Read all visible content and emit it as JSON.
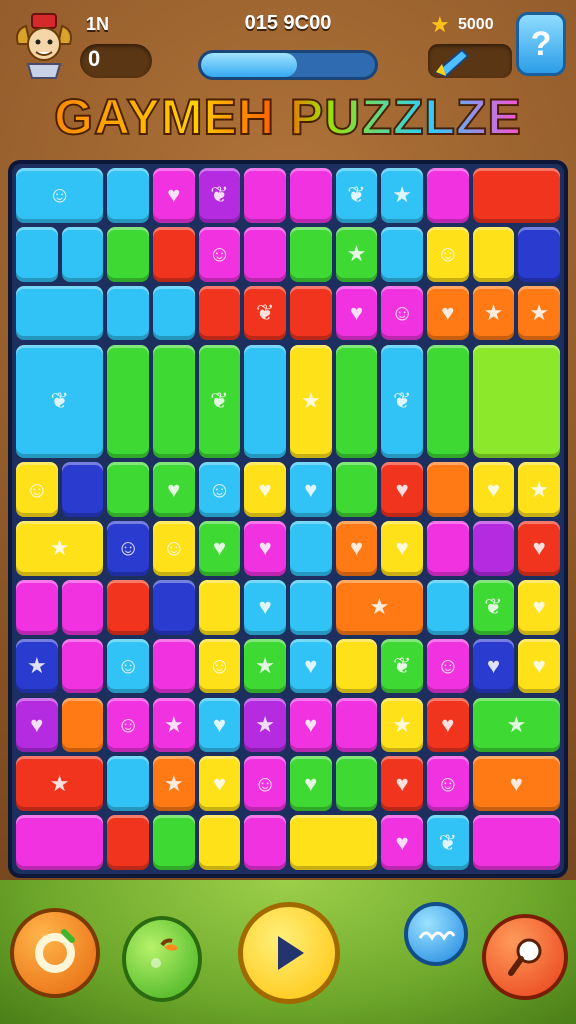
{
  "hud": {
    "level_label": "1N",
    "level_value": "0",
    "score_text": "015 9C00",
    "progress_fraction": 0.55,
    "coins_text": "5000"
  },
  "title": "GAYMEH PUZZLZE",
  "colors": {
    "cyan": "#31c3f5",
    "magenta": "#f032e0",
    "purple": "#b52be0",
    "green": "#3fd934",
    "lime": "#8be82a",
    "yellow": "#ffe11a",
    "orange": "#ff7a14",
    "red": "#f0341e",
    "navy": "#2a3bd0",
    "board": "#1d2f5e"
  },
  "board": {
    "cols": 12,
    "rows": 12,
    "tiles": [
      {
        "c": 0,
        "r": 0,
        "w": 2,
        "h": 1,
        "color": "cyan",
        "icon": "ghost-face"
      },
      {
        "c": 2,
        "r": 0,
        "w": 1,
        "h": 1,
        "color": "cyan"
      },
      {
        "c": 3,
        "r": 0,
        "w": 1,
        "h": 1,
        "color": "magenta",
        "icon": "heart"
      },
      {
        "c": 4,
        "r": 0,
        "w": 1,
        "h": 1,
        "color": "purple",
        "icon": "leaf"
      },
      {
        "c": 5,
        "r": 0,
        "w": 1,
        "h": 1,
        "color": "magenta"
      },
      {
        "c": 6,
        "r": 0,
        "w": 1,
        "h": 1,
        "color": "magenta"
      },
      {
        "c": 7,
        "r": 0,
        "w": 1,
        "h": 1,
        "color": "cyan",
        "icon": "leaf"
      },
      {
        "c": 8,
        "r": 0,
        "w": 1,
        "h": 1,
        "color": "cyan",
        "icon": "star"
      },
      {
        "c": 9,
        "r": 0,
        "w": 1,
        "h": 1,
        "color": "magenta"
      },
      {
        "c": 10,
        "r": 0,
        "w": 2,
        "h": 1,
        "color": "red"
      },
      {
        "c": 0,
        "r": 1,
        "w": 1,
        "h": 1,
        "color": "cyan"
      },
      {
        "c": 1,
        "r": 1,
        "w": 1,
        "h": 1,
        "color": "cyan"
      },
      {
        "c": 2,
        "r": 1,
        "w": 1,
        "h": 1,
        "color": "green"
      },
      {
        "c": 3,
        "r": 1,
        "w": 1,
        "h": 1,
        "color": "red"
      },
      {
        "c": 4,
        "r": 1,
        "w": 1,
        "h": 1,
        "color": "magenta",
        "icon": "face"
      },
      {
        "c": 5,
        "r": 1,
        "w": 1,
        "h": 1,
        "color": "magenta"
      },
      {
        "c": 6,
        "r": 1,
        "w": 1,
        "h": 1,
        "color": "green"
      },
      {
        "c": 7,
        "r": 1,
        "w": 1,
        "h": 1,
        "color": "green",
        "icon": "star"
      },
      {
        "c": 8,
        "r": 1,
        "w": 1,
        "h": 1,
        "color": "cyan"
      },
      {
        "c": 9,
        "r": 1,
        "w": 1,
        "h": 1,
        "color": "yellow",
        "icon": "face"
      },
      {
        "c": 10,
        "r": 1,
        "w": 1,
        "h": 1,
        "color": "yellow"
      },
      {
        "c": 11,
        "r": 1,
        "w": 1,
        "h": 1,
        "color": "navy"
      },
      {
        "c": 0,
        "r": 2,
        "w": 2,
        "h": 1,
        "color": "cyan"
      },
      {
        "c": 2,
        "r": 2,
        "w": 1,
        "h": 1,
        "color": "cyan"
      },
      {
        "c": 3,
        "r": 2,
        "w": 1,
        "h": 1,
        "color": "cyan"
      },
      {
        "c": 4,
        "r": 2,
        "w": 1,
        "h": 1,
        "color": "red"
      },
      {
        "c": 5,
        "r": 2,
        "w": 1,
        "h": 1,
        "color": "red",
        "icon": "leaf"
      },
      {
        "c": 6,
        "r": 2,
        "w": 1,
        "h": 1,
        "color": "red"
      },
      {
        "c": 7,
        "r": 2,
        "w": 1,
        "h": 1,
        "color": "magenta",
        "icon": "heart"
      },
      {
        "c": 8,
        "r": 2,
        "w": 1,
        "h": 1,
        "color": "magenta",
        "icon": "face"
      },
      {
        "c": 9,
        "r": 2,
        "w": 1,
        "h": 1,
        "color": "orange",
        "icon": "heart"
      },
      {
        "c": 10,
        "r": 2,
        "w": 1,
        "h": 1,
        "color": "orange",
        "icon": "star"
      },
      {
        "c": 11,
        "r": 2,
        "w": 1,
        "h": 1,
        "color": "orange",
        "icon": "star"
      },
      {
        "c": 0,
        "r": 3,
        "w": 2,
        "h": 2,
        "color": "cyan",
        "icon": "leaf"
      },
      {
        "c": 2,
        "r": 3,
        "w": 1,
        "h": 2,
        "color": "green"
      },
      {
        "c": 3,
        "r": 3,
        "w": 1,
        "h": 2,
        "color": "green"
      },
      {
        "c": 4,
        "r": 3,
        "w": 1,
        "h": 2,
        "color": "green",
        "icon": "leaf"
      },
      {
        "c": 5,
        "r": 3,
        "w": 1,
        "h": 2,
        "color": "cyan"
      },
      {
        "c": 6,
        "r": 3,
        "w": 1,
        "h": 2,
        "color": "yellow",
        "icon": "star"
      },
      {
        "c": 7,
        "r": 3,
        "w": 1,
        "h": 2,
        "color": "green"
      },
      {
        "c": 8,
        "r": 3,
        "w": 1,
        "h": 2,
        "color": "cyan",
        "icon": "leaf"
      },
      {
        "c": 9,
        "r": 3,
        "w": 1,
        "h": 2,
        "color": "green"
      },
      {
        "c": 10,
        "r": 3,
        "w": 2,
        "h": 2,
        "color": "lime"
      },
      {
        "c": 0,
        "r": 5,
        "w": 1,
        "h": 1,
        "color": "yellow",
        "icon": "face"
      },
      {
        "c": 1,
        "r": 5,
        "w": 1,
        "h": 1,
        "color": "navy"
      },
      {
        "c": 2,
        "r": 5,
        "w": 1,
        "h": 1,
        "color": "green"
      },
      {
        "c": 3,
        "r": 5,
        "w": 1,
        "h": 1,
        "color": "green",
        "icon": "heart"
      },
      {
        "c": 4,
        "r": 5,
        "w": 1,
        "h": 1,
        "color": "cyan",
        "icon": "face"
      },
      {
        "c": 5,
        "r": 5,
        "w": 1,
        "h": 1,
        "color": "yellow",
        "icon": "heart"
      },
      {
        "c": 6,
        "r": 5,
        "w": 1,
        "h": 1,
        "color": "cyan",
        "icon": "heart"
      },
      {
        "c": 7,
        "r": 5,
        "w": 1,
        "h": 1,
        "color": "green"
      },
      {
        "c": 8,
        "r": 5,
        "w": 1,
        "h": 1,
        "color": "red",
        "icon": "heart"
      },
      {
        "c": 9,
        "r": 5,
        "w": 1,
        "h": 1,
        "color": "orange"
      },
      {
        "c": 10,
        "r": 5,
        "w": 1,
        "h": 1,
        "color": "yellow",
        "icon": "heart"
      },
      {
        "c": 11,
        "r": 5,
        "w": 1,
        "h": 1,
        "color": "yellow",
        "icon": "star"
      },
      {
        "c": 0,
        "r": 6,
        "w": 2,
        "h": 1,
        "color": "yellow",
        "icon": "star"
      },
      {
        "c": 2,
        "r": 6,
        "w": 1,
        "h": 1,
        "color": "navy",
        "icon": "face"
      },
      {
        "c": 3,
        "r": 6,
        "w": 1,
        "h": 1,
        "color": "yellow",
        "icon": "face"
      },
      {
        "c": 4,
        "r": 6,
        "w": 1,
        "h": 1,
        "color": "green",
        "icon": "heart"
      },
      {
        "c": 5,
        "r": 6,
        "w": 1,
        "h": 1,
        "color": "magenta",
        "icon": "heart"
      },
      {
        "c": 6,
        "r": 6,
        "w": 1,
        "h": 1,
        "color": "cyan"
      },
      {
        "c": 7,
        "r": 6,
        "w": 1,
        "h": 1,
        "color": "orange",
        "icon": "heart"
      },
      {
        "c": 8,
        "r": 6,
        "w": 1,
        "h": 1,
        "color": "yellow",
        "icon": "heart"
      },
      {
        "c": 9,
        "r": 6,
        "w": 1,
        "h": 1,
        "color": "magenta"
      },
      {
        "c": 10,
        "r": 6,
        "w": 1,
        "h": 1,
        "color": "purple"
      },
      {
        "c": 11,
        "r": 6,
        "w": 1,
        "h": 1,
        "color": "red",
        "icon": "heart"
      },
      {
        "c": 0,
        "r": 7,
        "w": 1,
        "h": 1,
        "color": "magenta"
      },
      {
        "c": 1,
        "r": 7,
        "w": 1,
        "h": 1,
        "color": "magenta"
      },
      {
        "c": 2,
        "r": 7,
        "w": 1,
        "h": 1,
        "color": "red"
      },
      {
        "c": 3,
        "r": 7,
        "w": 1,
        "h": 1,
        "color": "navy"
      },
      {
        "c": 4,
        "r": 7,
        "w": 1,
        "h": 1,
        "color": "yellow"
      },
      {
        "c": 5,
        "r": 7,
        "w": 1,
        "h": 1,
        "color": "cyan",
        "icon": "heart"
      },
      {
        "c": 6,
        "r": 7,
        "w": 1,
        "h": 1,
        "color": "cyan"
      },
      {
        "c": 7,
        "r": 7,
        "w": 2,
        "h": 1,
        "color": "orange",
        "icon": "star"
      },
      {
        "c": 9,
        "r": 7,
        "w": 1,
        "h": 1,
        "color": "cyan"
      },
      {
        "c": 10,
        "r": 7,
        "w": 1,
        "h": 1,
        "color": "green",
        "icon": "leaf"
      },
      {
        "c": 11,
        "r": 7,
        "w": 1,
        "h": 1,
        "color": "yellow",
        "icon": "heart"
      },
      {
        "c": 0,
        "r": 8,
        "w": 1,
        "h": 1,
        "color": "navy",
        "icon": "star"
      },
      {
        "c": 1,
        "r": 8,
        "w": 1,
        "h": 1,
        "color": "magenta"
      },
      {
        "c": 2,
        "r": 8,
        "w": 1,
        "h": 1,
        "color": "cyan",
        "icon": "face"
      },
      {
        "c": 3,
        "r": 8,
        "w": 1,
        "h": 1,
        "color": "magenta"
      },
      {
        "c": 4,
        "r": 8,
        "w": 1,
        "h": 1,
        "color": "yellow",
        "icon": "face"
      },
      {
        "c": 5,
        "r": 8,
        "w": 1,
        "h": 1,
        "color": "green",
        "icon": "star"
      },
      {
        "c": 6,
        "r": 8,
        "w": 1,
        "h": 1,
        "color": "cyan",
        "icon": "heart"
      },
      {
        "c": 7,
        "r": 8,
        "w": 1,
        "h": 1,
        "color": "yellow"
      },
      {
        "c": 8,
        "r": 8,
        "w": 1,
        "h": 1,
        "color": "green",
        "icon": "leaf"
      },
      {
        "c": 9,
        "r": 8,
        "w": 1,
        "h": 1,
        "color": "magenta",
        "icon": "face"
      },
      {
        "c": 10,
        "r": 8,
        "w": 1,
        "h": 1,
        "color": "navy",
        "icon": "heart"
      },
      {
        "c": 11,
        "r": 8,
        "w": 1,
        "h": 1,
        "color": "yellow",
        "icon": "heart"
      },
      {
        "c": 0,
        "r": 9,
        "w": 1,
        "h": 1,
        "color": "purple",
        "icon": "heart"
      },
      {
        "c": 1,
        "r": 9,
        "w": 1,
        "h": 1,
        "color": "orange"
      },
      {
        "c": 2,
        "r": 9,
        "w": 1,
        "h": 1,
        "color": "magenta",
        "icon": "face"
      },
      {
        "c": 3,
        "r": 9,
        "w": 1,
        "h": 1,
        "color": "magenta",
        "icon": "star"
      },
      {
        "c": 4,
        "r": 9,
        "w": 1,
        "h": 1,
        "color": "cyan",
        "icon": "heart"
      },
      {
        "c": 5,
        "r": 9,
        "w": 1,
        "h": 1,
        "color": "purple",
        "icon": "star"
      },
      {
        "c": 6,
        "r": 9,
        "w": 1,
        "h": 1,
        "color": "magenta",
        "icon": "heart"
      },
      {
        "c": 7,
        "r": 9,
        "w": 1,
        "h": 1,
        "color": "magenta"
      },
      {
        "c": 8,
        "r": 9,
        "w": 1,
        "h": 1,
        "color": "yellow",
        "icon": "star"
      },
      {
        "c": 9,
        "r": 9,
        "w": 1,
        "h": 1,
        "color": "red",
        "icon": "heart"
      },
      {
        "c": 10,
        "r": 9,
        "w": 2,
        "h": 1,
        "color": "green",
        "icon": "star"
      },
      {
        "c": 0,
        "r": 10,
        "w": 2,
        "h": 1,
        "color": "red",
        "icon": "star"
      },
      {
        "c": 2,
        "r": 10,
        "w": 1,
        "h": 1,
        "color": "cyan"
      },
      {
        "c": 3,
        "r": 10,
        "w": 1,
        "h": 1,
        "color": "orange",
        "icon": "star"
      },
      {
        "c": 4,
        "r": 10,
        "w": 1,
        "h": 1,
        "color": "yellow",
        "icon": "heart"
      },
      {
        "c": 5,
        "r": 10,
        "w": 1,
        "h": 1,
        "color": "magenta",
        "icon": "face"
      },
      {
        "c": 6,
        "r": 10,
        "w": 1,
        "h": 1,
        "color": "green",
        "icon": "heart"
      },
      {
        "c": 7,
        "r": 10,
        "w": 1,
        "h": 1,
        "color": "green"
      },
      {
        "c": 8,
        "r": 10,
        "w": 1,
        "h": 1,
        "color": "red",
        "icon": "heart"
      },
      {
        "c": 9,
        "r": 10,
        "w": 1,
        "h": 1,
        "color": "magenta",
        "icon": "face"
      },
      {
        "c": 10,
        "r": 10,
        "w": 2,
        "h": 1,
        "color": "orange",
        "icon": "heart"
      },
      {
        "c": 0,
        "r": 11,
        "w": 2,
        "h": 1,
        "color": "magenta"
      },
      {
        "c": 2,
        "r": 11,
        "w": 1,
        "h": 1,
        "color": "red"
      },
      {
        "c": 3,
        "r": 11,
        "w": 1,
        "h": 1,
        "color": "green"
      },
      {
        "c": 4,
        "r": 11,
        "w": 1,
        "h": 1,
        "color": "yellow"
      },
      {
        "c": 5,
        "r": 11,
        "w": 1,
        "h": 1,
        "color": "magenta"
      },
      {
        "c": 6,
        "r": 11,
        "w": 2,
        "h": 1,
        "color": "yellow"
      },
      {
        "c": 8,
        "r": 11,
        "w": 1,
        "h": 1,
        "color": "magenta",
        "icon": "heart"
      },
      {
        "c": 9,
        "r": 11,
        "w": 1,
        "h": 1,
        "color": "cyan",
        "icon": "leaf"
      },
      {
        "c": 10,
        "r": 11,
        "w": 2,
        "h": 1,
        "color": "magenta"
      }
    ]
  },
  "icons": {
    "star": "★",
    "heart": "♥",
    "face": "☺",
    "leaf": "❦",
    "ghost-face": "☺"
  },
  "controls": {
    "buttons": [
      {
        "name": "fruit-ring-button",
        "icon": "fruit-ring-icon"
      },
      {
        "name": "green-apple-button",
        "icon": "apple-icon"
      },
      {
        "name": "play-button",
        "icon": "play-icon"
      },
      {
        "name": "blue-bubble-button",
        "icon": "bubble-icon"
      },
      {
        "name": "hint-button",
        "icon": "magnifier-icon"
      }
    ]
  }
}
